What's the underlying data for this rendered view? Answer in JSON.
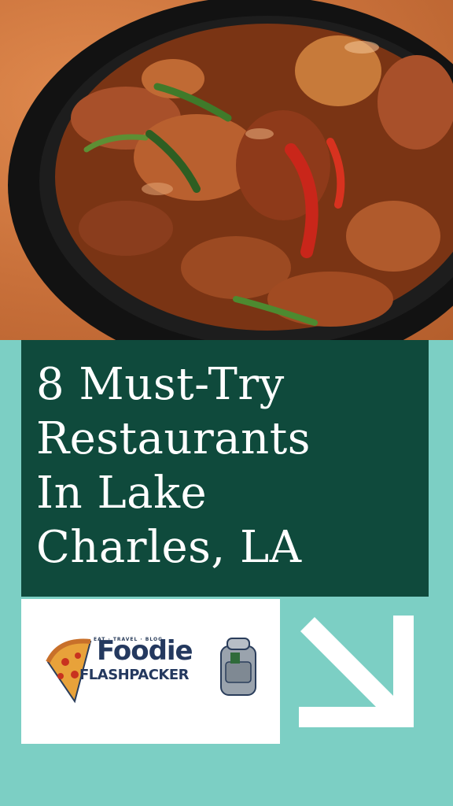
{
  "hero": {
    "image": "food-bowl-photo"
  },
  "title": {
    "line1": "8 Must-Try",
    "line2": "Restaurants",
    "line3": "In Lake",
    "line4": "Charles, LA"
  },
  "logo": {
    "tagline": "EAT · TRAVEL · BLOG",
    "word1": "Foodie",
    "word2": "FLASHPACKER",
    "icons": [
      "pizza-icon",
      "backpack-icon"
    ]
  },
  "arrow": {
    "icon": "arrow-down-right-icon"
  },
  "colors": {
    "background": "#7ccfc4",
    "title_box": "#0f4a3c",
    "title_text": "#ffffff",
    "logo_text": "#24395f"
  }
}
